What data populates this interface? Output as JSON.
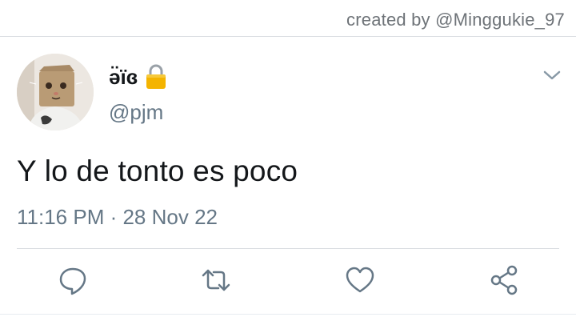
{
  "credit": {
    "text": "created by @Minggukie_97"
  },
  "tweet": {
    "display_name": "ə̈ïɞ",
    "handle": "@pjm",
    "protected_icon": "lock-icon",
    "text": "Y lo de tonto es poco",
    "timestamp": "11:16 PM · 28 Nov 22"
  },
  "actions": [
    {
      "name": "reply",
      "icon": "speech-bubble-icon"
    },
    {
      "name": "retweet",
      "icon": "retweet-icon"
    },
    {
      "name": "like",
      "icon": "heart-icon"
    },
    {
      "name": "share",
      "icon": "share-icon"
    }
  ],
  "colors": {
    "text": "#14171a",
    "secondary": "#657786",
    "divider": "#d9dde1",
    "lock_gold": "#f4b400"
  }
}
